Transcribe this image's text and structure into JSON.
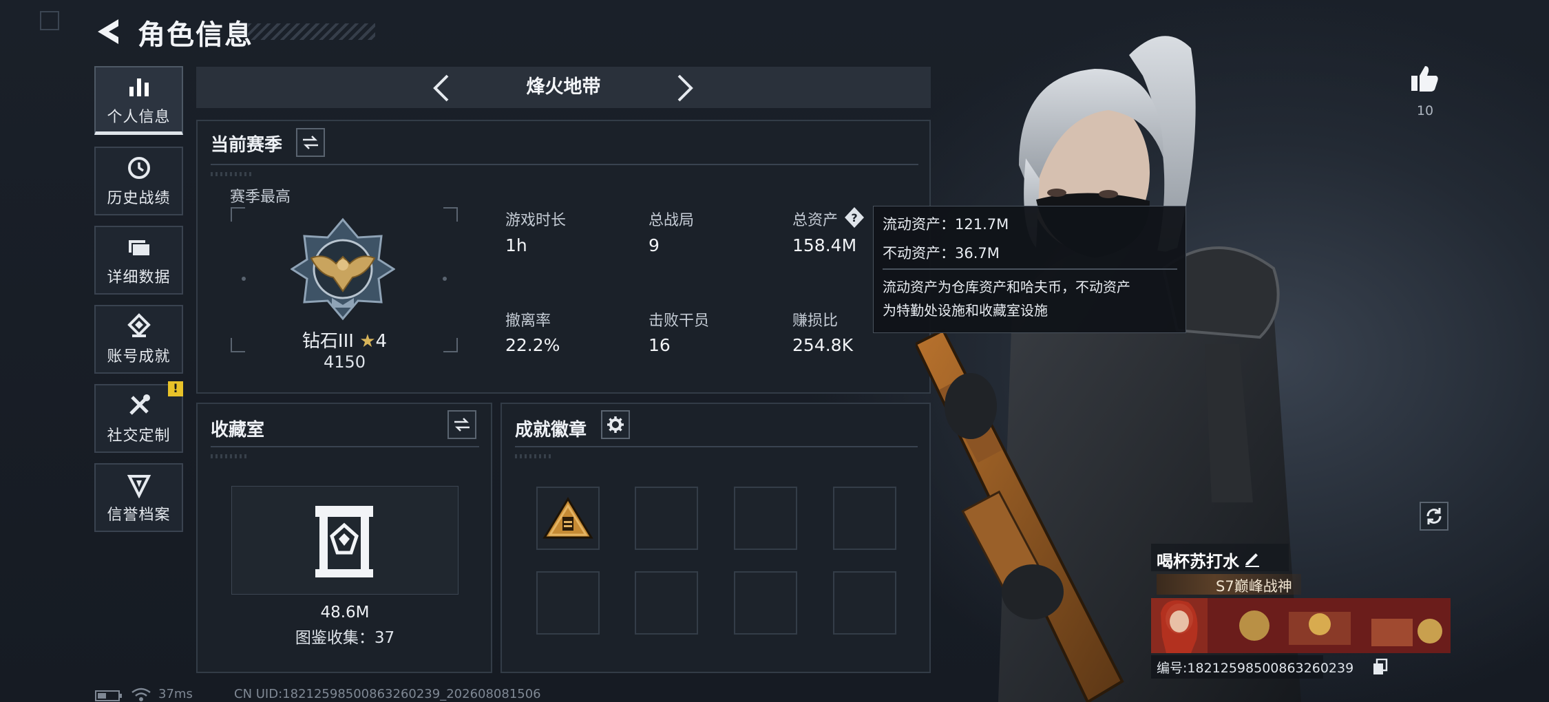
{
  "header": {
    "title": "角色信息"
  },
  "sidebar": {
    "items": [
      {
        "label": "个人信息",
        "icon": "bar-chart-icon",
        "active": true
      },
      {
        "label": "历史战绩",
        "icon": "history-icon",
        "active": false
      },
      {
        "label": "详细数据",
        "icon": "folder-icon",
        "active": false
      },
      {
        "label": "账号成就",
        "icon": "achievement-icon",
        "active": false
      },
      {
        "label": "社交定制",
        "icon": "tools-icon",
        "active": false,
        "badge": "!"
      },
      {
        "label": "信誉档案",
        "icon": "shield-badge-icon",
        "active": false
      }
    ]
  },
  "mode": {
    "title": "烽火地带"
  },
  "season": {
    "heading": "当前赛季",
    "best_label": "赛季最高",
    "rank_name": "钻石III",
    "rank_stars": "4",
    "rank_score": "4150",
    "stats": [
      {
        "label": "游戏时长",
        "value": "1h"
      },
      {
        "label": "总战局",
        "value": "9"
      },
      {
        "label": "总资产",
        "value": "158.4M"
      },
      {
        "label": "撤离率",
        "value": "22.2%"
      },
      {
        "label": "击败干员",
        "value": "16"
      },
      {
        "label": "赚损比",
        "value": "254.8K"
      }
    ]
  },
  "tooltip": {
    "liquid": "流动资产：121.7M",
    "fixed": "不动资产：36.7M",
    "desc_line1": "流动资产为仓库资产和哈夫币，不动资产",
    "desc_line2": "为特勤处设施和收藏室设施"
  },
  "collection": {
    "heading": "收藏室",
    "value": "48.6M",
    "collected": "图鉴收集：37"
  },
  "badges": {
    "heading": "成就徽章"
  },
  "likes": {
    "count": "10"
  },
  "profile": {
    "name": "喝杯苏打水",
    "title": "S7巅峰战神",
    "id_text": "编号:18212598500863260239"
  },
  "footer": {
    "ping": "37ms",
    "uid": "CN UID:18212598500863260239_202608081506"
  },
  "colors": {
    "accent_gold": "#e8c229",
    "panel": "#1b2129",
    "border": "#333c47"
  }
}
